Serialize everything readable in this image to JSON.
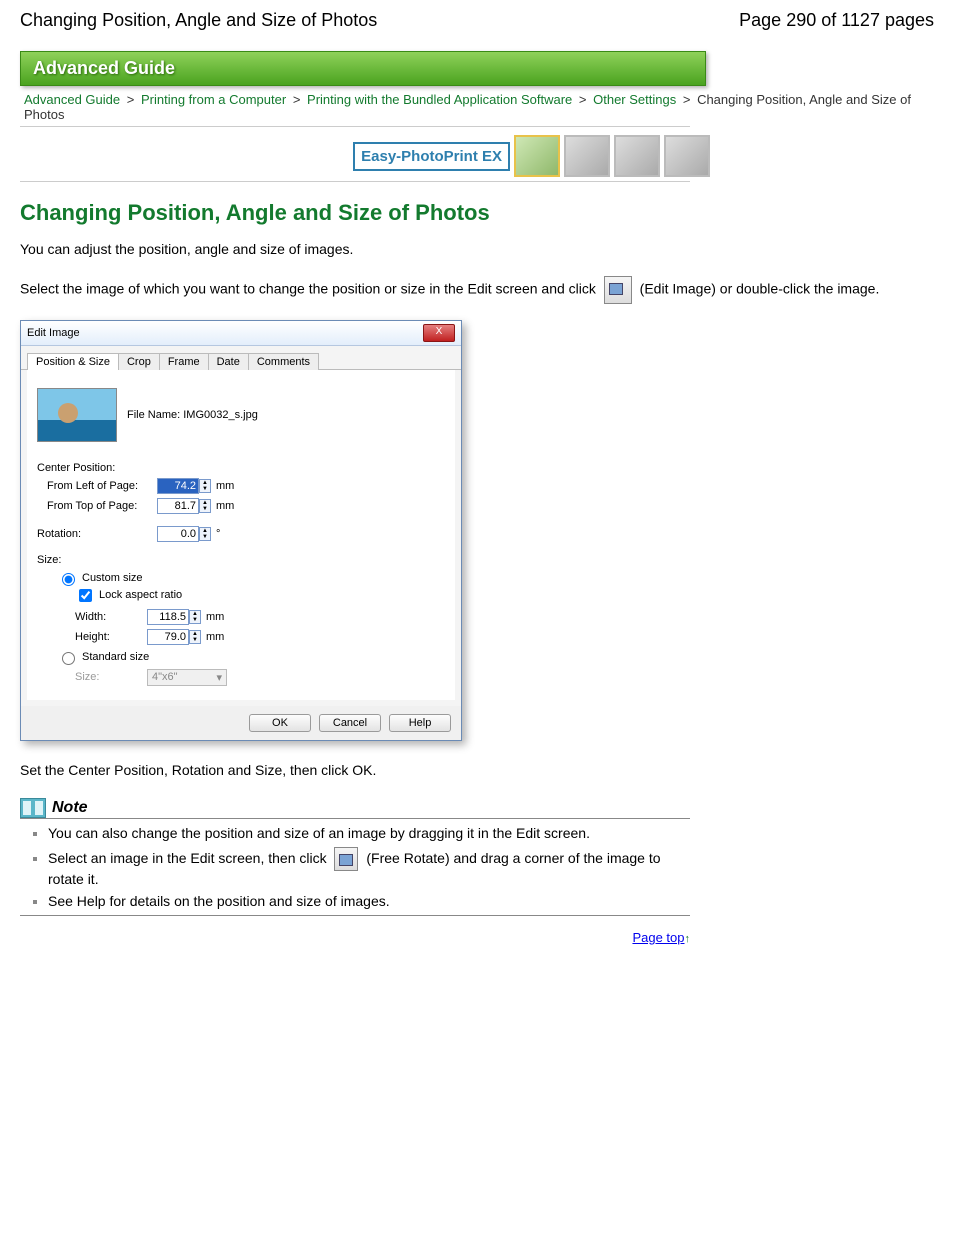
{
  "top": {
    "title": "Changing Position, Angle and Size of Photos",
    "page_of": "Page 290 of 1127 pages"
  },
  "banner": "Advanced Guide",
  "breadcrumb": {
    "items": [
      "Advanced Guide",
      "Printing from a Computer",
      "Printing with the Bundled Application Software",
      "Other Settings"
    ],
    "current": "Changing Position, Angle and Size of Photos",
    "sep": ">"
  },
  "logo": "Easy-PhotoPrint EX",
  "heading": "Changing Position, Angle and Size of Photos",
  "intro": "You can adjust the position, angle and size of images.",
  "select_text_1": "Select the image of which you want to change the position or size in the Edit screen and click",
  "select_text_2": " (Edit Image) or double-click the image.",
  "dialog": {
    "title": "Edit Image",
    "close": "X",
    "tabs": [
      "Position & Size",
      "Crop",
      "Frame",
      "Date",
      "Comments"
    ],
    "file_label": "File Name: IMG0032_s.jpg",
    "center_position": "Center Position:",
    "from_left": "From Left of Page:",
    "from_left_val": "74.2",
    "from_top": "From Top of Page:",
    "from_top_val": "81.7",
    "unit_mm": "mm",
    "rotation": "Rotation:",
    "rotation_val": "0.0",
    "unit_deg": "°",
    "size": "Size:",
    "custom": "Custom size",
    "lock": "Lock aspect ratio",
    "width": "Width:",
    "width_val": "118.5",
    "height": "Height:",
    "height_val": "79.0",
    "standard": "Standard size",
    "size_label": "Size:",
    "size_select": "4\"x6\"",
    "ok": "OK",
    "cancel": "Cancel",
    "help": "Help"
  },
  "after_dialog": "Set the Center Position, Rotation and Size, then click OK.",
  "note": {
    "title": "Note",
    "items": [
      "You can also change the position and size of an image by dragging it in the Edit screen.",
      "Select an image in the Edit screen, then click  (Free Rotate) and drag a corner of the image to rotate it.",
      "See Help for details on the position and size of images."
    ],
    "item2_pre": "Select an image in the Edit screen, then click ",
    "item2_post": " (Free Rotate) and drag a corner of the image to rotate it."
  },
  "page_top": "Page top"
}
